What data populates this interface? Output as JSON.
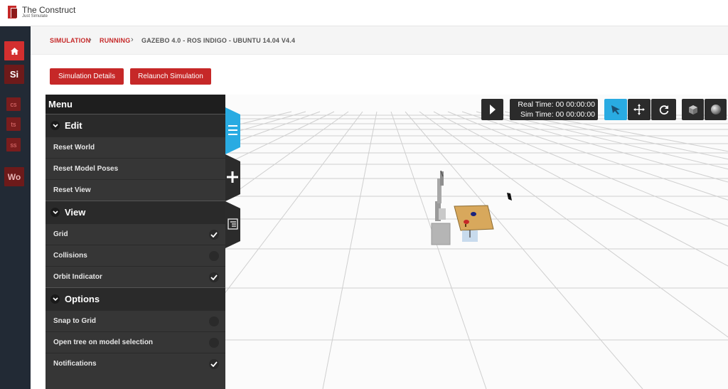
{
  "brand": {
    "title": "The Construct",
    "subtitle": "Just Simulate"
  },
  "sidebar": {
    "items": [
      {
        "label": "Si"
      },
      {
        "label": "cs"
      },
      {
        "label": "ts"
      },
      {
        "label": "ss"
      },
      {
        "label": "Wo"
      }
    ]
  },
  "breadcrumb": {
    "items": [
      "SIMULATION",
      "RUNNING",
      "GAZEBO 4.0 - ROS INDIGO - UBUNTU 14.04 V4.4"
    ],
    "separator": "›"
  },
  "actions": {
    "details_label": "Simulation Details",
    "relaunch_label": "Relaunch Simulation"
  },
  "toolbar": {
    "real_time": "Real Time: 00 00:00:00",
    "sim_time": "Sim Time: 00 00:00:00"
  },
  "menu": {
    "title": "Menu",
    "sections": [
      {
        "label": "Edit",
        "items": [
          "Reset World",
          "Reset Model Poses",
          "Reset View"
        ]
      },
      {
        "label": "View",
        "items": [
          {
            "label": "Grid",
            "checked": true
          },
          {
            "label": "Collisions",
            "checked": false
          },
          {
            "label": "Orbit Indicator",
            "checked": true
          }
        ]
      },
      {
        "label": "Options",
        "items": [
          {
            "label": "Snap to Grid",
            "checked": false
          },
          {
            "label": "Open tree on model selection",
            "checked": false
          },
          {
            "label": "Notifications",
            "checked": true
          }
        ]
      }
    ]
  },
  "colors": {
    "brand_red": "#c62828",
    "sidebar_bg": "#222a35",
    "accent_blue": "#29abe2",
    "menu_bg": "#363636"
  },
  "icons": {
    "home": "home-icon",
    "play": "play-icon",
    "select": "select-arrow-icon",
    "translate": "translate-icon",
    "rotate": "rotate-icon",
    "box": "box-shape-icon",
    "sphere": "sphere-shape-icon"
  }
}
